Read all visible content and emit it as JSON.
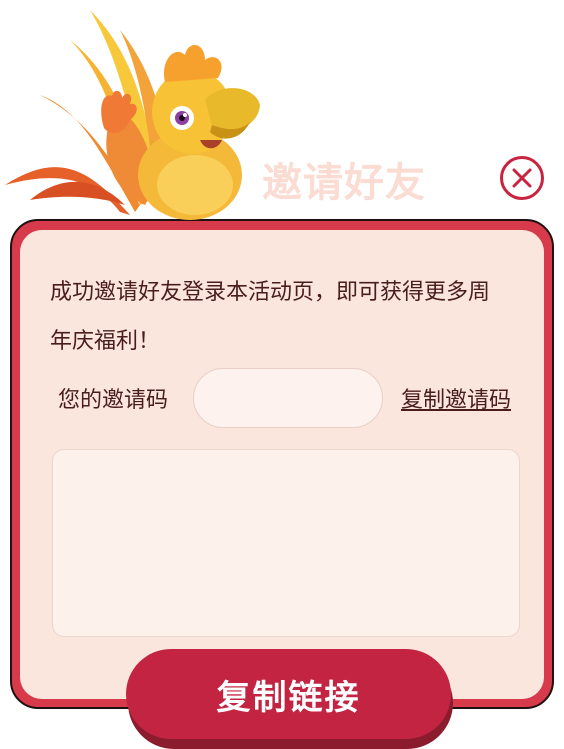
{
  "dialog": {
    "title": "邀请好友",
    "description": "成功邀请好友登录本活动页，即可获得更多周年庆福利！",
    "code_label": "您的邀请码",
    "code_value": "",
    "copy_code_label": "复制邀请码",
    "link_value": "",
    "copy_link_label": "复制链接"
  },
  "colors": {
    "accent": "#c32442",
    "card_border": "#d63a4b",
    "card_bg": "#fbe6de",
    "title_faded": "#fadcd3",
    "text": "#4a1d1d"
  },
  "icons": {
    "close": "close-icon",
    "mascot": "phoenix-mascot"
  }
}
